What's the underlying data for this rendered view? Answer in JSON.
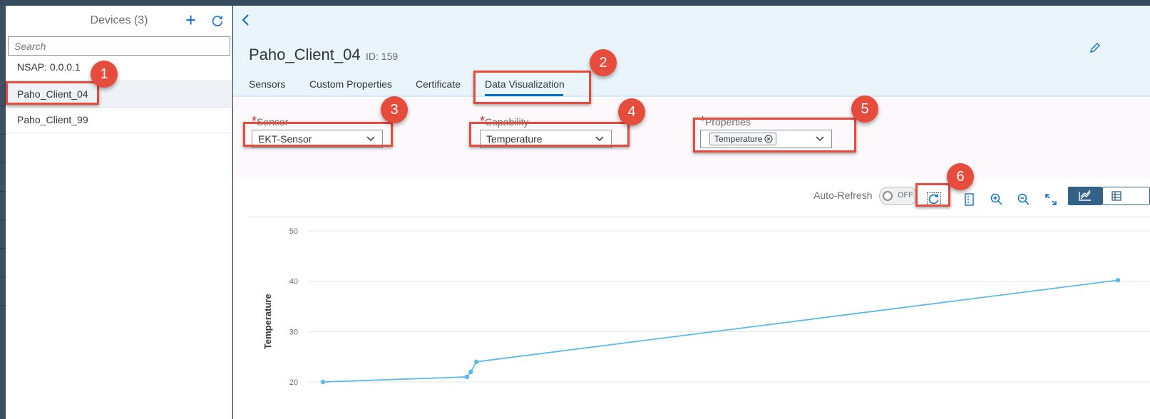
{
  "sidebar": {
    "title": "Devices (3)",
    "search_placeholder": "Search",
    "devices": [
      {
        "label": "NSAP: 0.0.0.1"
      },
      {
        "label": "Paho_Client_04"
      },
      {
        "label": "Paho_Client_99"
      }
    ],
    "selected": "Paho_Client_04"
  },
  "header": {
    "title": "Paho_Client_04",
    "id_text": "ID: 159",
    "tabs": [
      {
        "label": "Sensors"
      },
      {
        "label": "Custom Properties"
      },
      {
        "label": "Certificate"
      },
      {
        "label": "Data Visualization"
      }
    ],
    "active_tab": "Data Visualization"
  },
  "filters": {
    "sensor": {
      "label": "Sensor",
      "value": "EKT-Sensor"
    },
    "capability": {
      "label": "Capability",
      "value": "Temperature"
    },
    "properties": {
      "label": "Properties",
      "token": "Temperature"
    }
  },
  "chart_toolbar": {
    "auto_refresh_label": "Auto-Refresh",
    "toggle_state": "OFF"
  },
  "callouts": [
    "1",
    "2",
    "3",
    "4",
    "5",
    "6"
  ],
  "colors": {
    "accent": "#0a6ed1",
    "highlight": "#e64c3c",
    "series": "#5cbae6",
    "header_bg": "#eaf4fb"
  },
  "chart_data": {
    "type": "line",
    "ylabel": "Temperature",
    "yticks": [
      20,
      30,
      40,
      50
    ],
    "ylim": [
      18,
      52
    ],
    "grid": true,
    "series": [
      {
        "values": [
          {
            "x": 0,
            "y": 20
          },
          {
            "x": 0.181,
            "y": 21
          },
          {
            "x": 0.186,
            "y": 22
          },
          {
            "x": 0.193,
            "y": 24
          },
          {
            "x": 1.0,
            "y": 40.2
          }
        ]
      }
    ]
  }
}
